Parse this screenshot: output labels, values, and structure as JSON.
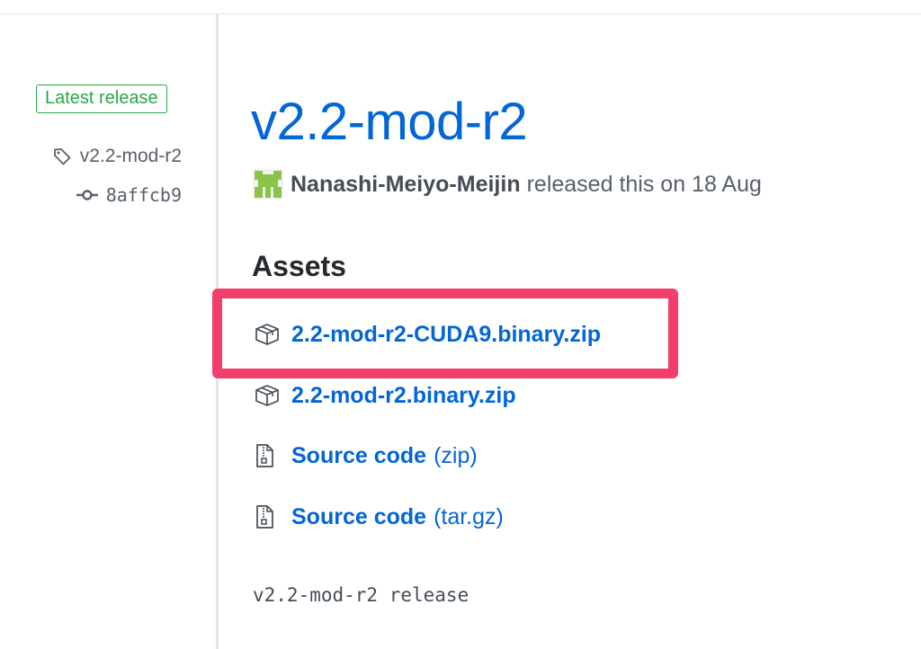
{
  "sidebar": {
    "badge_label": "Latest release",
    "tag_name": "v2.2-mod-r2",
    "commit_sha": "8affcb9"
  },
  "release": {
    "title": "v2.2-mod-r2",
    "author": "Nanashi-Meiyo-Meijin",
    "released_text": "released this on 18 Aug",
    "assets_heading": "Assets",
    "assets": [
      {
        "name": "2.2-mod-r2-CUDA9.binary.zip",
        "icon": "package-icon"
      },
      {
        "name": "2.2-mod-r2.binary.zip",
        "icon": "package-icon"
      },
      {
        "name": "Source code",
        "suffix": "(zip)",
        "icon": "file-zip-icon"
      },
      {
        "name": "Source code",
        "suffix": "(tar.gz)",
        "icon": "file-zip-icon"
      }
    ],
    "notes": "v2.2-mod-r2 release"
  },
  "colors": {
    "link": "#0366d6",
    "badge_green": "#28a745",
    "highlight": "#f23e6a",
    "muted_text": "#586069"
  }
}
